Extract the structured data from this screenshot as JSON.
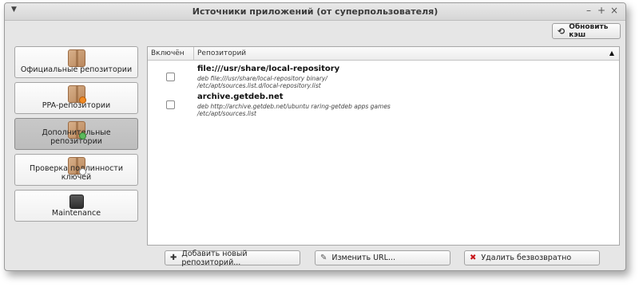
{
  "window": {
    "title": "Источники приложений (от суперпользователя)",
    "menu_icon": "chevron-down-icon",
    "controls": {
      "minimize": "–",
      "maximize": "+",
      "close": "×"
    }
  },
  "toolbar": {
    "refresh_label": "Обновить кэш",
    "refresh_icon": "refresh-icon"
  },
  "sidebar": {
    "items": [
      {
        "label": "Официальные репозитории",
        "icon": "package-icon",
        "active": false
      },
      {
        "label": "PPA-репозитории",
        "icon": "package-ppa-icon",
        "active": false
      },
      {
        "label": "Дополнительные репозитории",
        "icon": "package-add-icon",
        "active": true
      },
      {
        "label": "Проверка подлинности ключей",
        "icon": "package-key-icon",
        "active": false
      },
      {
        "label": "Maintenance",
        "icon": "maintenance-icon",
        "active": false
      }
    ]
  },
  "table": {
    "columns": [
      "Включён",
      "Репозиторий"
    ],
    "sort_icon": "▲",
    "rows": [
      {
        "enabled": false,
        "name": "file:///usr/share/local-repository",
        "line1": "deb file:///usr/share/local-repository binary/",
        "line2": "/etc/apt/sources.list.d/local-repository.list"
      },
      {
        "enabled": false,
        "name": "archive.getdeb.net",
        "line1": "deb http://archive.getdeb.net/ubuntu raring-getdeb apps games",
        "line2": "/etc/apt/sources.list"
      }
    ]
  },
  "buttons": {
    "add": "Добавить новый репозиторий...",
    "edit": "Изменить URL...",
    "delete": "Удалить безвозвратно"
  },
  "colors": {
    "delete_icon": "#c8171b",
    "window_bg": "#e6e6e6"
  }
}
